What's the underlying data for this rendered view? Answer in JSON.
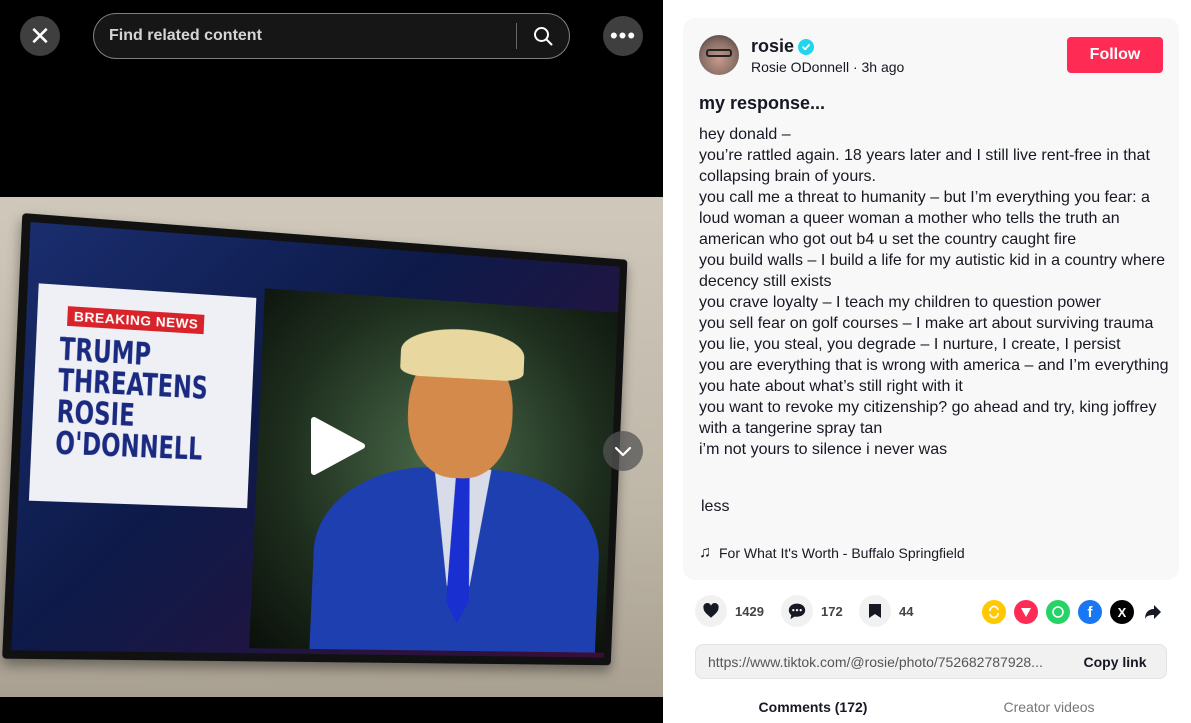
{
  "topbar": {
    "search_placeholder": "Find related content"
  },
  "media": {
    "breaking_label": "BREAKING NEWS",
    "headline": "TRUMP\nTHREATENS\nROSIE O'DONNELL"
  },
  "author": {
    "username": "rosie",
    "display_name": "Rosie ODonnell",
    "posted": "3h ago",
    "follow_label": "Follow"
  },
  "post": {
    "title": "my response...",
    "body": "hey donald –\nyou’re rattled again. 18 years later and I still live rent-free in that collapsing brain of yours.\nyou call me a threat to humanity – but I’m everything you fear: a loud woman a queer woman a mother who tells the truth an american who got out b4 u set the country caught fire\nyou build walls – I build a life for my autistic kid in a country where decency still exists\nyou crave loyalty – I teach my children to question power\nyou sell fear on golf courses – I make art about surviving trauma\nyou lie, you steal, you degrade – I nurture, I create, I persist\nyou are everything that is wrong with america – and I’m everything you hate about what’s still right with it\nyou want to revoke my citizenship? go ahead and try, king joffrey with a tangerine spray tan\ni’m not yours to silence i never was",
    "less_label": "less",
    "music": "For What It's Worth - Buffalo Springfield"
  },
  "stats": {
    "likes": "1429",
    "comments": "172",
    "saves": "44"
  },
  "share": {
    "link": "https://www.tiktok.com/@rosie/photo/752682787928...",
    "copy_label": "Copy link"
  },
  "tabs": {
    "comments": "Comments (172)",
    "creator": "Creator videos"
  }
}
